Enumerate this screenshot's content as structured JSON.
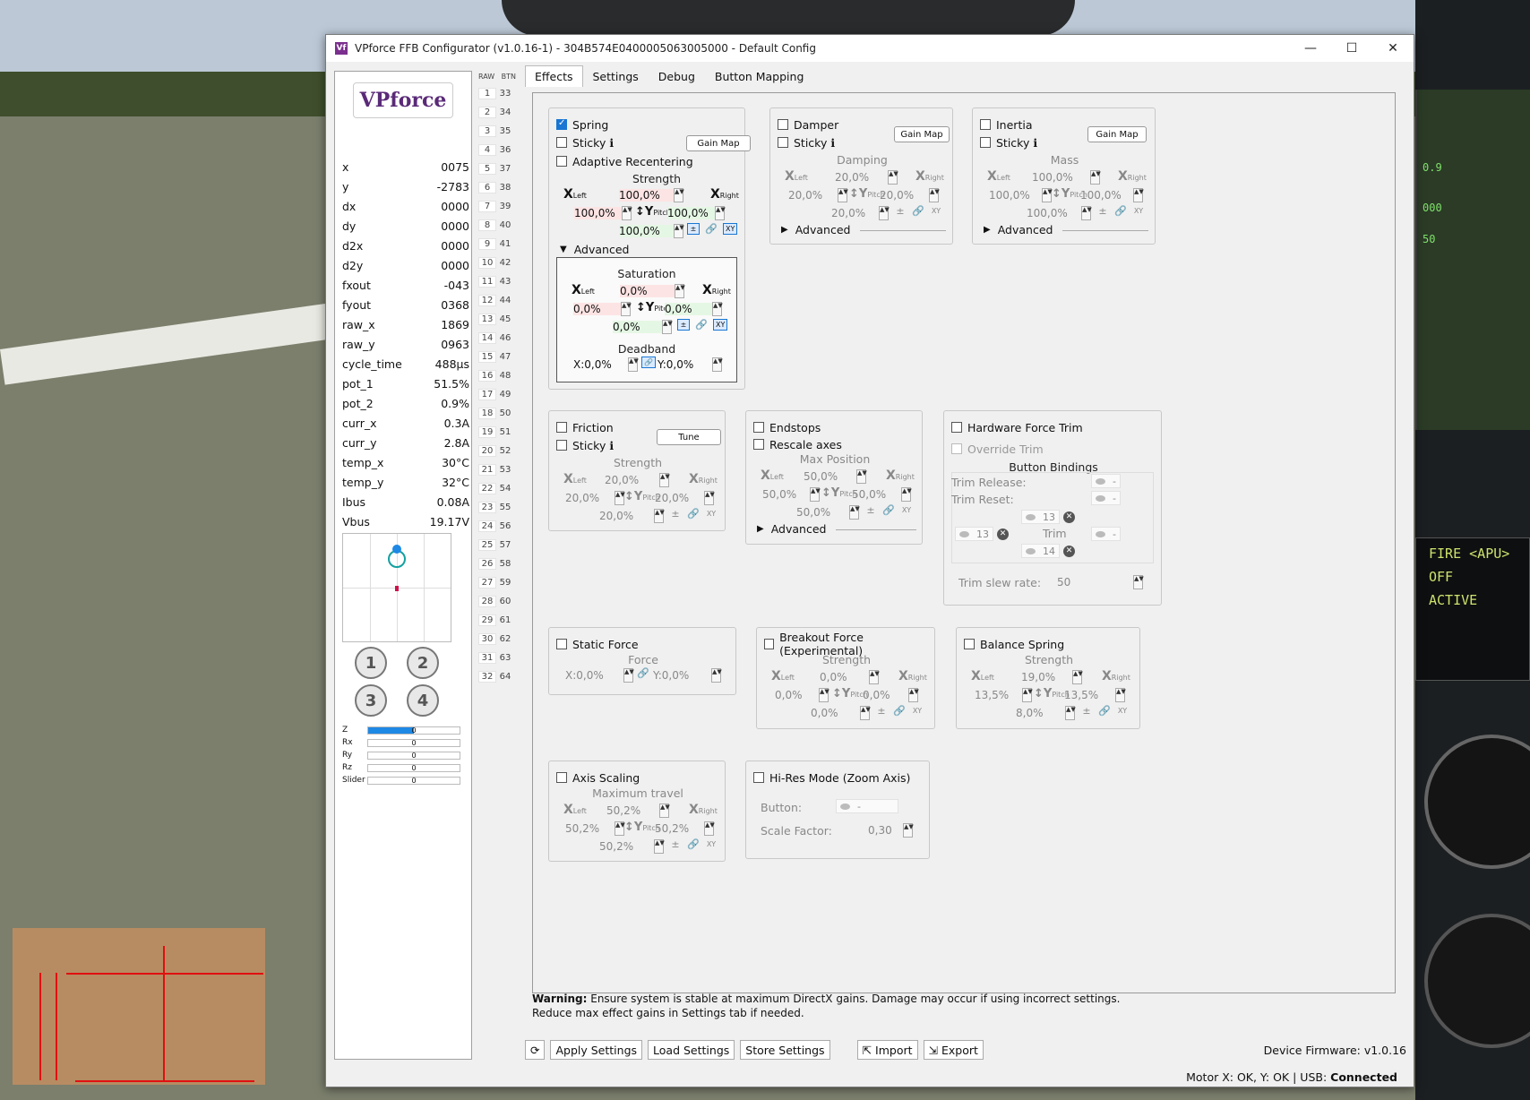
{
  "window": {
    "title": "VPforce FFB Configurator (v1.0.16-1) - 304B574E0400005063005000 - Default Config",
    "app_icon": "Vf",
    "min_glyph": "—",
    "max_glyph": "☐",
    "close_glyph": "✕"
  },
  "logo": "VPforce",
  "telemetry": [
    {
      "label": "x",
      "value": "0075"
    },
    {
      "label": "y",
      "value": "-2783"
    },
    {
      "label": "dx",
      "value": "0000"
    },
    {
      "label": "dy",
      "value": "0000"
    },
    {
      "label": "d2x",
      "value": "0000"
    },
    {
      "label": "d2y",
      "value": "0000"
    },
    {
      "label": "fxout",
      "value": "-043"
    },
    {
      "label": "fyout",
      "value": "0368"
    },
    {
      "label": "raw_x",
      "value": "1869"
    },
    {
      "label": "raw_y",
      "value": "0963"
    },
    {
      "label": "cycle_time",
      "value": "488μs"
    },
    {
      "label": "pot_1",
      "value": "51.5%"
    },
    {
      "label": "pot_2",
      "value": "0.9%"
    },
    {
      "label": "curr_x",
      "value": "0.3A"
    },
    {
      "label": "curr_y",
      "value": "2.8A"
    },
    {
      "label": "temp_x",
      "value": "30°C"
    },
    {
      "label": "temp_y",
      "value": "32°C"
    },
    {
      "label": "Ibus",
      "value": "0.08A"
    },
    {
      "label": "Vbus",
      "value": "19.17V"
    }
  ],
  "hat_buttons": [
    "1",
    "2",
    "3",
    "4"
  ],
  "axes": [
    {
      "name": "Z",
      "value": "0",
      "fill": 0.5
    },
    {
      "name": "Rx",
      "value": "0",
      "fill": 0
    },
    {
      "name": "Ry",
      "value": "0",
      "fill": 0
    },
    {
      "name": "Rz",
      "value": "0",
      "fill": 0
    },
    {
      "name": "Slider",
      "value": "0",
      "fill": 0
    }
  ],
  "raw_header": {
    "raw": "RAW",
    "btn": "BTN"
  },
  "raw_rows": [
    [
      "1",
      "33"
    ],
    [
      "2",
      "34"
    ],
    [
      "3",
      "35"
    ],
    [
      "4",
      "36"
    ],
    [
      "5",
      "37"
    ],
    [
      "6",
      "38"
    ],
    [
      "7",
      "39"
    ],
    [
      "8",
      "40"
    ],
    [
      "9",
      "41"
    ],
    [
      "10",
      "42"
    ],
    [
      "11",
      "43"
    ],
    [
      "12",
      "44"
    ],
    [
      "13",
      "45"
    ],
    [
      "14",
      "46"
    ],
    [
      "15",
      "47"
    ],
    [
      "16",
      "48"
    ],
    [
      "17",
      "49"
    ],
    [
      "18",
      "50"
    ],
    [
      "19",
      "51"
    ],
    [
      "20",
      "52"
    ],
    [
      "21",
      "53"
    ],
    [
      "22",
      "54"
    ],
    [
      "23",
      "55"
    ],
    [
      "24",
      "56"
    ],
    [
      "25",
      "57"
    ],
    [
      "26",
      "58"
    ],
    [
      "27",
      "59"
    ],
    [
      "28",
      "60"
    ],
    [
      "29",
      "61"
    ],
    [
      "30",
      "62"
    ],
    [
      "31",
      "63"
    ],
    [
      "32",
      "64"
    ]
  ],
  "tabs": [
    "Effects",
    "Settings",
    "Debug",
    "Button Mapping"
  ],
  "common": {
    "x_left": "X",
    "left_sub": "Left",
    "x_right": "X",
    "right_sub": "Right",
    "y_pitch": "↕Y",
    "pitch_sub": "Pitch",
    "plusminus": "±",
    "link": "🔗",
    "xy": "XY",
    "arrow": "▲▼"
  },
  "spring": {
    "enabled": "Spring",
    "sticky": "Sticky ℹ",
    "adaptive": "Adaptive Recentering",
    "gain_map": "Gain Map",
    "strength_label": "Strength",
    "top": "100,0%",
    "left": "100,0%",
    "right": "100,0%",
    "bottom": "100,0%",
    "advanced": "Advanced",
    "saturation_label": "Saturation",
    "sat_top": "0,0%",
    "sat_left": "0,0%",
    "sat_right": "0,0%",
    "sat_bottom": "0,0%",
    "deadband_label": "Deadband",
    "db_x": "X:0,0%",
    "db_y": "Y:0,0%"
  },
  "damper": {
    "enabled": "Damper",
    "sticky": "Sticky ℹ",
    "gain_map": "Gain Map",
    "label": "Damping",
    "top": "20,0%",
    "left": "20,0%",
    "right": "20,0%",
    "bottom": "20,0%",
    "advanced": "Advanced"
  },
  "inertia": {
    "enabled": "Inertia",
    "sticky": "Sticky ℹ",
    "gain_map": "Gain Map",
    "label": "Mass",
    "top": "100,0%",
    "left": "100,0%",
    "right": "100,0%",
    "bottom": "100,0%",
    "advanced": "Advanced"
  },
  "friction": {
    "enabled": "Friction",
    "sticky": "Sticky ℹ",
    "tune": "Tune",
    "label": "Strength",
    "top": "20,0%",
    "left": "20,0%",
    "right": "20,0%",
    "bottom": "20,0%"
  },
  "endstops": {
    "enabled": "Endstops",
    "rescale": "Rescale axes",
    "label": "Max Position",
    "top": "50,0%",
    "left": "50,0%",
    "right": "50,0%",
    "bottom": "50,0%",
    "advanced": "Advanced"
  },
  "hw_trim": {
    "enabled": "Hardware Force Trim",
    "override": "Override Trim",
    "bindings_title": "Button Bindings",
    "release_label": "Trim Release:",
    "release_value": "-",
    "reset_label": "Trim Reset:",
    "reset_value": "-",
    "up": "13",
    "left": "13",
    "right": "-",
    "down": "14",
    "center": "Trim",
    "slew_label": "Trim slew rate:",
    "slew_value": "50"
  },
  "static_force": {
    "enabled": "Static Force",
    "label": "Force",
    "x": "X:0,0%",
    "y": "Y:0,0%"
  },
  "breakout": {
    "enabled": "Breakout Force (Experimental)",
    "label": "Strength",
    "top": "0,0%",
    "left": "0,0%",
    "right": "0,0%",
    "bottom": "0,0%"
  },
  "balance": {
    "enabled": "Balance Spring",
    "label": "Strength",
    "top": "19,0%",
    "left": "13,5%",
    "right": "13,5%",
    "bottom": "8,0%"
  },
  "axis_scaling": {
    "enabled": "Axis Scaling",
    "label": "Maximum travel",
    "top": "50,2%",
    "left": "50,2%",
    "right": "50,2%",
    "bottom": "50,2%"
  },
  "hires": {
    "enabled": "Hi-Res Mode (Zoom Axis)",
    "button_label": "Button:",
    "button_value": "-",
    "scale_label": "Scale Factor:",
    "scale_value": "0,30"
  },
  "warning": {
    "bold": "Warning:",
    "line1": " Ensure system is stable at maximum DirectX gains. Damage may occur if using incorrect settings.",
    "line2": "Reduce max effect gains in Settings tab if needed."
  },
  "bottom": {
    "refresh": "⟳",
    "apply": "Apply Settings",
    "load": "Load Settings",
    "store": "Store Settings",
    "import": "Import",
    "export": "Export",
    "firmware": "Device Firmware: v1.0.16",
    "status_prefix": "Motor X: OK, Y: OK | USB: ",
    "status_conn": "Connected"
  },
  "background": {
    "hud_texts": [
      "0.9",
      "000",
      "50",
      "FIRE <APU>",
      "OFF",
      "ACTIVE"
    ]
  }
}
